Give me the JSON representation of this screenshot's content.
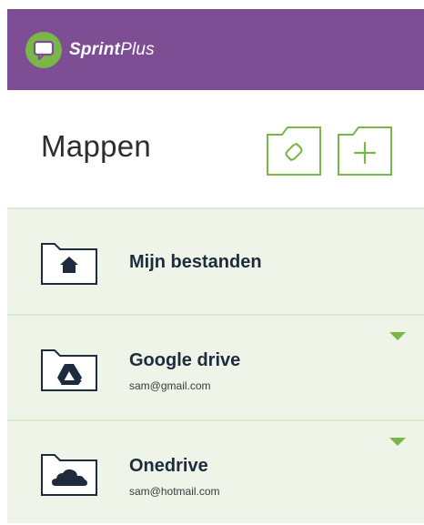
{
  "header": {
    "brand_bold": "Sprint",
    "brand_light": "Plus",
    "logo_icon": "chat-bubble-icon",
    "bg_color": "#7e4e95",
    "accent_color": "#7ab648"
  },
  "title": {
    "text": "Mappen",
    "actions": [
      {
        "icon": "link-folder-icon"
      },
      {
        "icon": "new-folder-icon"
      }
    ]
  },
  "folders": [
    {
      "label": "Mijn bestanden",
      "sub": "",
      "icon": "home-folder-icon",
      "expandable": false
    },
    {
      "label": "Google drive",
      "sub": "sam@gmail.com",
      "icon": "google-drive-folder-icon",
      "expandable": true
    },
    {
      "label": "Onedrive",
      "sub": "sam@hotmail.com",
      "icon": "onedrive-folder-icon",
      "expandable": true
    }
  ]
}
